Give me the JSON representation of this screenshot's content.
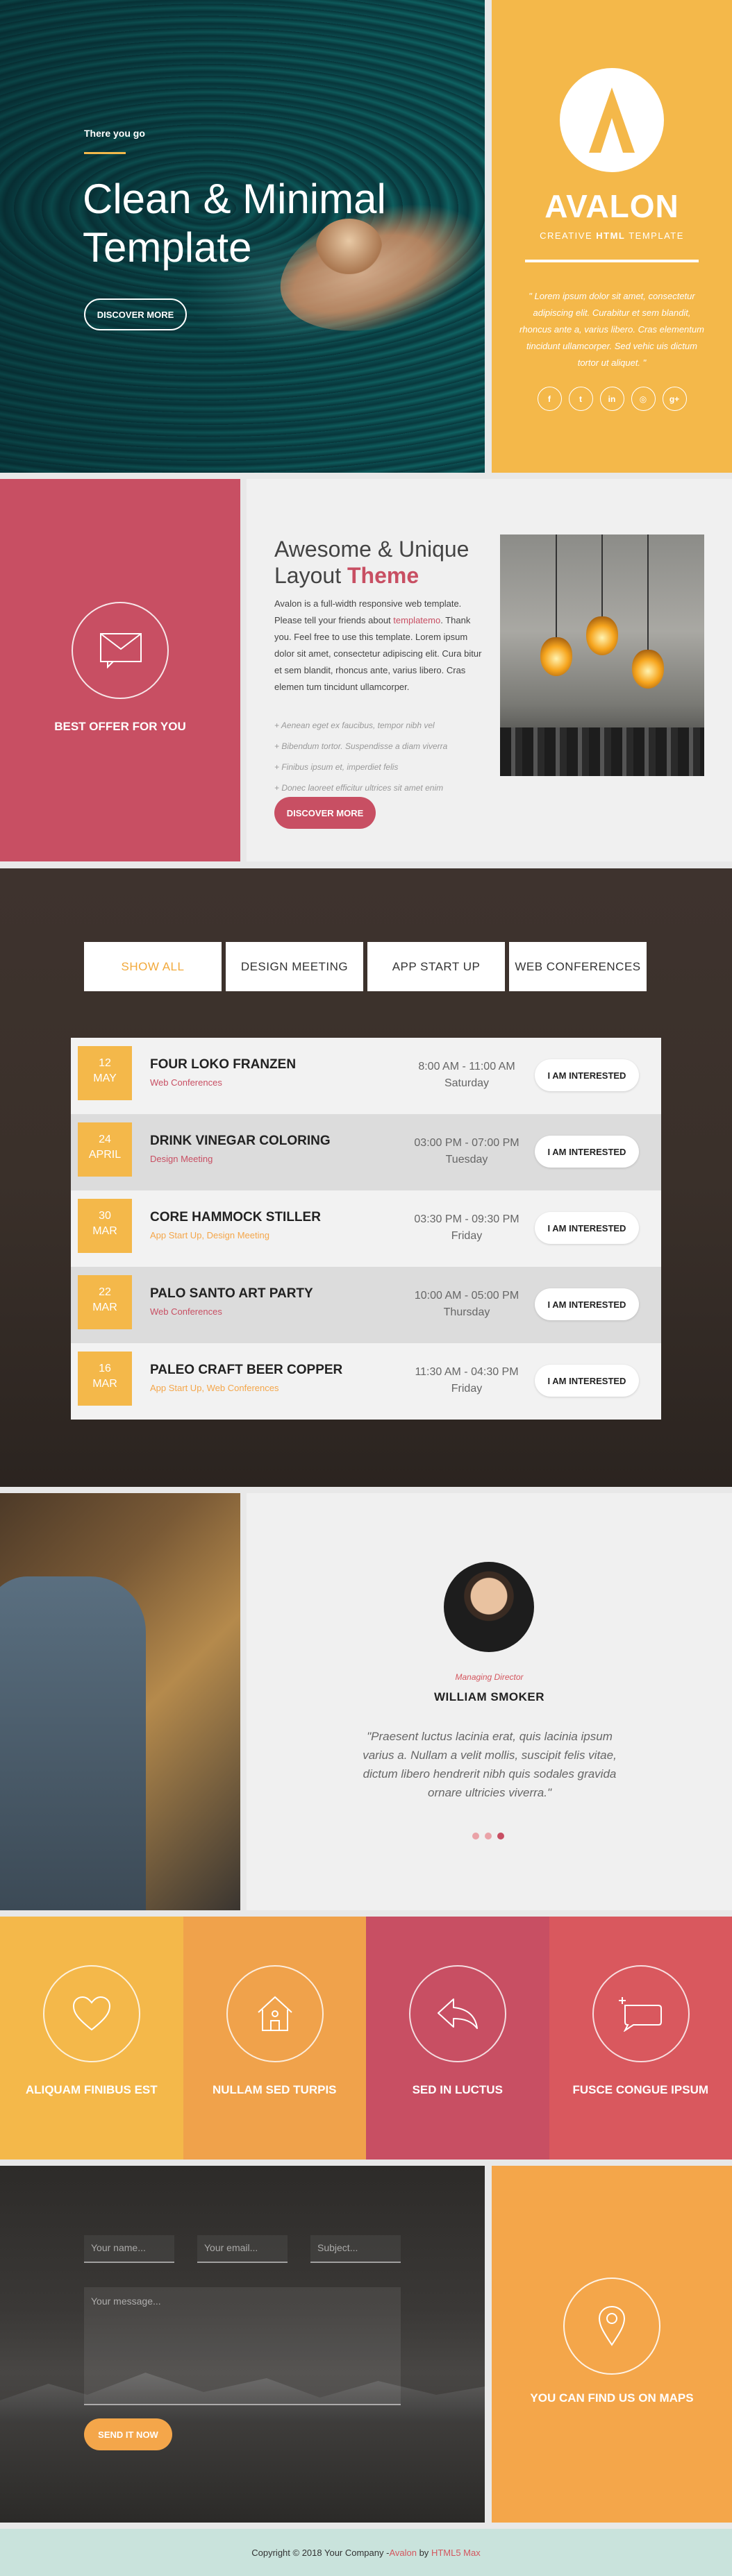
{
  "hero": {
    "eyebrow": "There you go",
    "title_line1": "Clean & Minimal",
    "title_line2": "Template",
    "cta": "DISCOVER MORE"
  },
  "brand": {
    "name": "AVALON",
    "tagline_pre": "CREATIVE ",
    "tagline_bold": "HTML",
    "tagline_post": " TEMPLATE",
    "quote": "\" Lorem ipsum dolor sit amet, consectetur adipiscing elit. Curabitur et sem blandit, rhoncus ante a, varius libero. Cras elementum tincidunt ullamcorper. Sed vehic uis dictum tortor ut aliquet. \"",
    "socials": [
      {
        "icon": "facebook-icon",
        "glyph": "f"
      },
      {
        "icon": "twitter-icon",
        "glyph": "t"
      },
      {
        "icon": "linkedin-icon",
        "glyph": "in"
      },
      {
        "icon": "rss-icon",
        "glyph": "◎"
      },
      {
        "icon": "google-plus-icon",
        "glyph": "g+"
      }
    ],
    "color": "#f4b84a"
  },
  "offer": {
    "label": "BEST OFFER FOR YOU",
    "color": "#c84f63"
  },
  "about": {
    "title_pre": "Awesome & Unique",
    "title_line2_pre": "Layout ",
    "title_highlight": "Theme",
    "body_pre": "Avalon is a full-width responsive web template. Please tell your friends about ",
    "body_link": "templatemo",
    "body_post": ". Thank you. Feel free to use this template. Lorem ipsum dolor sit amet, consectetur adipiscing elit. Cura bitur et sem blandit, rhoncus ante, varius libero. Cras elemen tum tincidunt ullamcorper.",
    "list": [
      "+ Aenean eget ex faucibus, tempor nibh vel",
      "+ Bibendum tortor. Suspendisse a diam viverra",
      "+ Finibus ipsum et, imperdiet felis",
      "+ Donec laoreet efficitur ultrices sit amet enim"
    ],
    "cta": "DISCOVER MORE"
  },
  "schedule": {
    "filters": [
      "SHOW ALL",
      "DESIGN MEETING",
      "APP START UP",
      "WEB CONFERENCES"
    ],
    "events": [
      {
        "day": "12",
        "month": "MAY",
        "title": "FOUR LOKO FRANZEN",
        "category": "Web Conferences",
        "cat_color": "#c84f63",
        "time": "8:00 AM - 11:00 AM",
        "weekday": "Saturday",
        "button": "I AM INTERESTED"
      },
      {
        "day": "24",
        "month": "APRIL",
        "title": "DRINK VINEGAR COLORING",
        "category": "Design Meeting",
        "cat_color": "#c84f63",
        "time": "03:00 PM - 07:00 PM",
        "weekday": "Tuesday",
        "button": "I AM INTERESTED"
      },
      {
        "day": "30",
        "month": "MAR",
        "title": "CORE HAMMOCK STILLER",
        "category": "App Start Up, Design Meeting",
        "cat_color": "#f4a64a",
        "time": "03:30 PM - 09:30 PM",
        "weekday": "Friday",
        "button": "I AM INTERESTED"
      },
      {
        "day": "22",
        "month": "MAR",
        "title": "PALO SANTO ART PARTY",
        "category": "Web Conferences",
        "cat_color": "#c84f63",
        "time": "10:00 AM - 05:00 PM",
        "weekday": "Thursday",
        "button": "I AM INTERESTED"
      },
      {
        "day": "16",
        "month": "MAR",
        "title": "PALEO CRAFT BEER COPPER",
        "category": "App Start Up, Web Conferences",
        "cat_color": "#f4a64a",
        "time": "11:30 AM - 04:30 PM",
        "weekday": "Friday",
        "button": "I AM INTERESTED"
      }
    ]
  },
  "testimonial": {
    "role": "Managing Director",
    "name": "WILLIAM SMOKER",
    "quote": "\"Praesent luctus lacinia erat, quis lacinia ipsum varius a. Nullam a velit mollis, suscipit felis vitae, dictum libero hendrerit nibh quis sodales gravida ornare ultricies viverra.\""
  },
  "services": [
    {
      "label": "ALIQUAM FINIBUS EST",
      "icon": "heart-icon",
      "color": "#f4b84a"
    },
    {
      "label": "NULLAM SED TURPIS",
      "icon": "home-icon",
      "color": "#f0a24b"
    },
    {
      "label": "SED IN LUCTUS",
      "icon": "reply-arrow-icon",
      "color": "#c84f63"
    },
    {
      "label": "FUSCE CONGUE IPSUM",
      "icon": "chat-icon",
      "color": "#d9585e"
    }
  ],
  "contact": {
    "name_placeholder": "Your name...",
    "email_placeholder": "Your email...",
    "subject_placeholder": "Subject...",
    "message_placeholder": "Your message...",
    "send": "SEND IT NOW"
  },
  "map": {
    "label": "YOU CAN FIND US ON MAPS"
  },
  "footer": {
    "pre": "Copyright © 2018 Your Company - ",
    "link1": "Avalon",
    "mid": " by ",
    "link2": "HTML5 Max"
  }
}
